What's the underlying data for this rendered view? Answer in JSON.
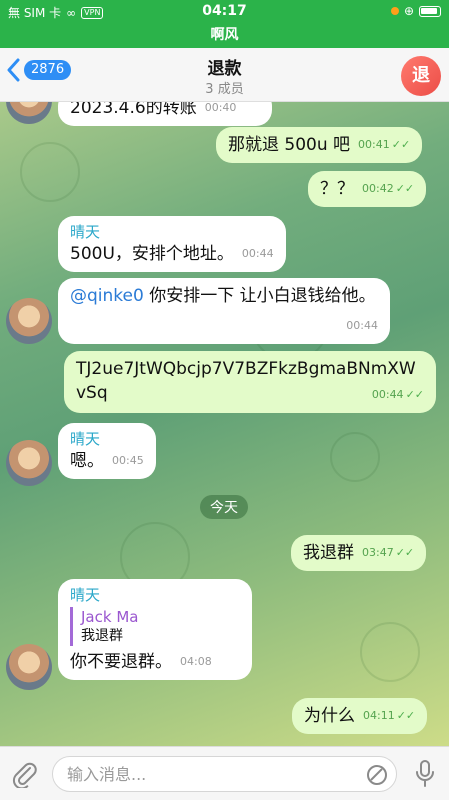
{
  "status_bar": {
    "carrier": "無 SIM 卡",
    "vpn": "VPN",
    "time": "04:17"
  },
  "notice_strip": {
    "text": "啊风"
  },
  "header": {
    "unread": "2876",
    "title": "退款",
    "subtitle": "3 成员",
    "avatar_letter": "退"
  },
  "messages": [
    {
      "direction": "in",
      "text": "2023.4.6的转账",
      "time": "00:40"
    },
    {
      "direction": "out",
      "text": "那就退 500u 吧",
      "time": "00:41"
    },
    {
      "direction": "out",
      "text": "？？",
      "time": "00:42"
    },
    {
      "direction": "in",
      "sender": "晴天",
      "text": "500U，安排个地址。",
      "time": "00:44"
    },
    {
      "direction": "in",
      "mention": "@qinke0",
      "text": "  你安排一下 让小白退钱给他。",
      "time": "00:44"
    },
    {
      "direction": "out",
      "text": "TJ2ue7JtWQbcjp7V7BZFkzBgmaBNmXWvSq",
      "time": "00:44"
    },
    {
      "direction": "in",
      "sender": "晴天",
      "text": "嗯。",
      "time": "00:45"
    },
    {
      "direction": "out",
      "text": "我退群",
      "time": "03:47"
    },
    {
      "direction": "in",
      "sender": "晴天",
      "reply_name": "Jack Ma",
      "reply_text": "我退群",
      "text": "你不要退群。",
      "time": "04:08"
    },
    {
      "direction": "out",
      "text": "为什么",
      "time": "04:11"
    }
  ],
  "day_separator": "今天",
  "input": {
    "placeholder": "输入消息..."
  },
  "colors": {
    "status_green": "#2bb34a",
    "outgoing_bubble": "#e3fbc9",
    "accent_blue": "#2e8ef5",
    "sender_cyan": "#2aa7c9"
  }
}
